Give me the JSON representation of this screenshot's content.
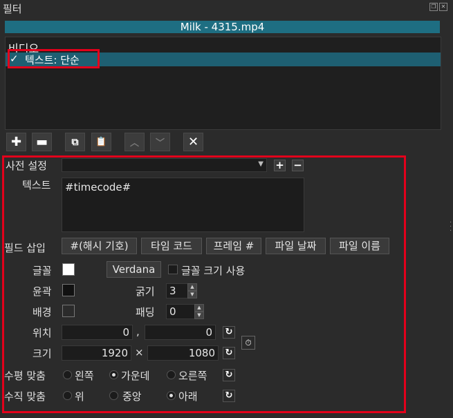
{
  "panel": {
    "title": "필터"
  },
  "file": {
    "name": "Milk - 4315.mp4"
  },
  "filter_list": {
    "header": "비디오",
    "items": [
      {
        "check": "✓",
        "label": "텍스트: 단순"
      }
    ]
  },
  "toolbar": {
    "add": "✚",
    "remove": "▬",
    "copy": "⧉",
    "paste": "📋",
    "up": "︿",
    "down": "﹀",
    "deselect": "✕"
  },
  "preset": {
    "label": "사전 설정",
    "value": ""
  },
  "text": {
    "label": "텍스트",
    "value": "#timecode#"
  },
  "insert_field": {
    "label": "필드 삽입",
    "buttons": [
      "#(해시 기호)",
      "타임 코드",
      "프레임 #",
      "파일 날짜",
      "파일 이름"
    ]
  },
  "font": {
    "label": "글꼴",
    "name": "Verdana",
    "size_label": "글꼴 크기 사용",
    "color": "#ffffff"
  },
  "outline": {
    "label": "윤곽",
    "color": "#111111",
    "thickness_label": "굵기",
    "thickness": "3"
  },
  "background": {
    "label": "배경",
    "color": "#2b2b2b",
    "padding_label": "패딩",
    "padding": "0"
  },
  "position": {
    "label": "위치",
    "x": "0",
    "sep": ",",
    "y": "0"
  },
  "size": {
    "label": "크기",
    "w": "1920",
    "sep": "×",
    "h": "1080"
  },
  "halign": {
    "label": "수평 맞춤",
    "options": [
      "왼쪽",
      "가운데",
      "오른쪽"
    ],
    "selected": "가운데"
  },
  "valign": {
    "label": "수직 맞춤",
    "options": [
      "위",
      "중앙",
      "아래"
    ],
    "selected": "아래"
  },
  "icons": {
    "reset": "reset-icon",
    "timer": "stopwatch-icon"
  }
}
